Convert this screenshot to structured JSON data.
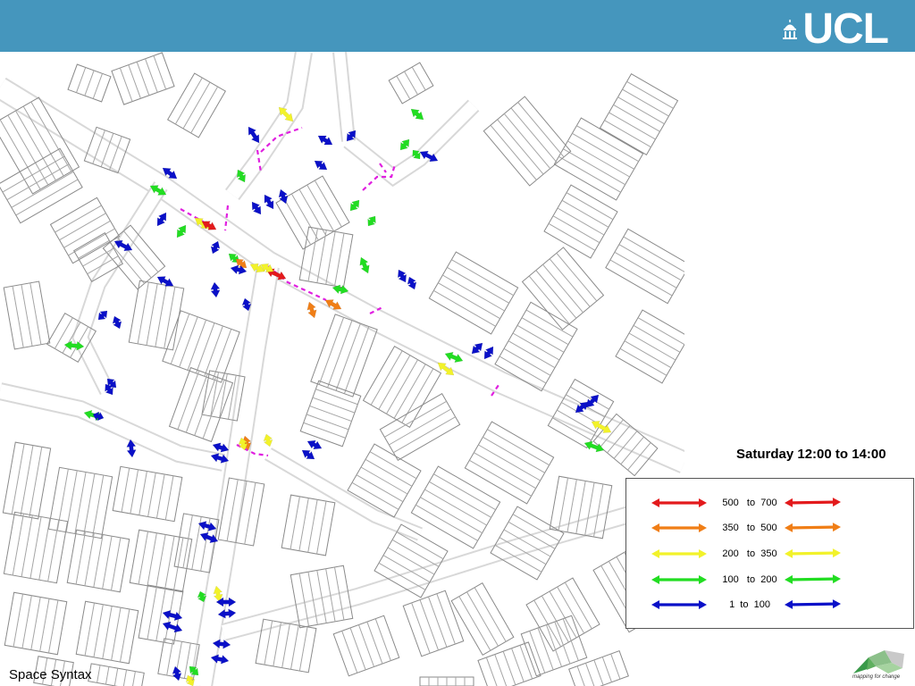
{
  "header": {
    "logo_text": "UCL",
    "brand_color": "#4596bd"
  },
  "title": "Saturday 12:00 to 14:00",
  "map_label": "Space Syntax",
  "footer_logo_text": "mapping for change",
  "legend": [
    {
      "label": "500   to  700",
      "color": "#e31a1c"
    },
    {
      "label": "350   to  500",
      "color": "#f07e16"
    },
    {
      "label": "200   to  350",
      "color": "#f2f22a"
    },
    {
      "label": "100   to  200",
      "color": "#22dd22"
    },
    {
      "label": "1  to  100",
      "color": "#0a10c8"
    }
  ],
  "gate_color": "#e020e0"
}
